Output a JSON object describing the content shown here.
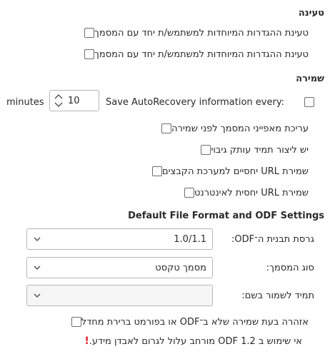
{
  "load": {
    "heading": "טעינה",
    "items": [
      {
        "label": "טעינת ההגדרות המיוחדות למשתמש/ת יחד עם המסמך",
        "checked": false
      },
      {
        "label": "טעינת ההגדרות המיוחדות למשתמש/ת יחד עם המסמך",
        "checked": false
      }
    ]
  },
  "save": {
    "heading": "שמירה",
    "autorecovery": {
      "label": "Save AutoRecovery information every:",
      "value": "10",
      "unit": "minutes",
      "checked": false
    },
    "items": [
      {
        "label": "עריכת מאפייני המסמך לפני שמירה",
        "checked": false
      },
      {
        "label": "יש ליצור תמיד עותק גיבוי",
        "checked": false
      },
      {
        "label": "שמירת URL יחסיים למערכת הקבצים",
        "checked": false
      },
      {
        "label": "שמירת URL יחסית לאינטרנט",
        "checked": false
      }
    ]
  },
  "odf": {
    "heading": "Default File Format and ODF Settings",
    "version_label": "גרסת תבנית ה־ODF:",
    "version_value": "1.0/1.1",
    "doctype_label": "סוג המסמך:",
    "doctype_value": "מסמך טקסט",
    "always_save_label": "תמיד לשמור בשם:",
    "always_save_value": "",
    "warn_checkbox_label": "אזהרה בעת שמירה שלא ב־ODF או בפורמט ברירת מחדל",
    "warn_checked": false,
    "warning_text": "אי שימוש ב 1.2 ODF מורחב עלול לגרום לאבדן מידע.",
    "warning_icon": "exclamation-icon"
  }
}
